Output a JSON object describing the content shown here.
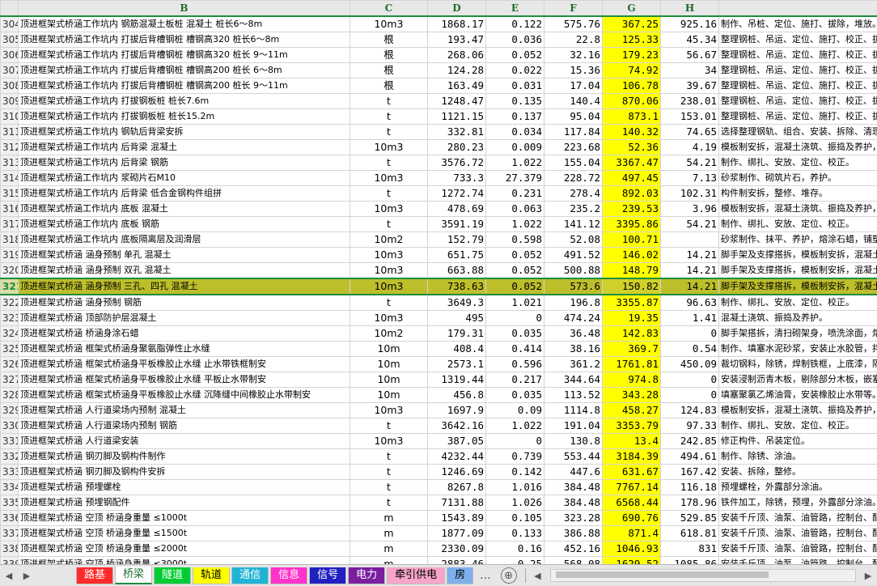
{
  "columns": [
    "B",
    "C",
    "D",
    "E",
    "F",
    "G",
    "H"
  ],
  "rows": [
    {
      "n": "304",
      "b": "顶进框架式桥涵工作坑内 钢筋混凝土板桩 混凝土 桩长6～8m",
      "c": "10m3",
      "d": "1868.17",
      "e": "0.122",
      "f": "575.76",
      "g": "367.25",
      "h": "925.16",
      "i": "制作、吊桩、定位、施打、拔除，堆放。"
    },
    {
      "n": "305",
      "b": "顶进框架式桥涵工作坑内 打拔后背槽钢桩 槽钢高320 桩长6～8m",
      "c": "根",
      "d": "193.47",
      "e": "0.036",
      "f": "22.8",
      "g": "125.33",
      "h": "45.34",
      "i": "整理钢桩、吊运、定位、施打、校正、拔"
    },
    {
      "n": "306",
      "b": "顶进框架式桥涵工作坑内 打拔后背槽钢桩 槽钢高320 桩长 9～11m",
      "c": "根",
      "d": "268.06",
      "e": "0.052",
      "f": "32.16",
      "g": "179.23",
      "h": "56.67",
      "i": "整理钢桩、吊运、定位、施打、校正、拔"
    },
    {
      "n": "307",
      "b": "顶进框架式桥涵工作坑内 打拔后背槽钢桩 槽钢高200 桩长 6～8m",
      "c": "根",
      "d": "124.28",
      "e": "0.022",
      "f": "15.36",
      "g": "74.92",
      "h": "34",
      "i": "整理钢桩、吊运、定位、施打、校正、拔"
    },
    {
      "n": "308",
      "b": "顶进框架式桥涵工作坑内 打拔后背槽钢桩 槽钢高200 桩长 9～11m",
      "c": "根",
      "d": "163.49",
      "e": "0.031",
      "f": "17.04",
      "g": "106.78",
      "h": "39.67",
      "i": "整理钢桩、吊运、定位、施打、校正、拔"
    },
    {
      "n": "309",
      "b": "顶进框架式桥涵工作坑内 打拔钢板桩 桩长7.6m",
      "c": "t",
      "d": "1248.47",
      "e": "0.135",
      "f": "140.4",
      "g": "870.06",
      "h": "238.01",
      "i": "整理钢桩、吊运、定位、施打、校正、拔"
    },
    {
      "n": "310",
      "b": "顶进框架式桥涵工作坑内 打拔钢板桩 桩长15.2m",
      "c": "t",
      "d": "1121.15",
      "e": "0.137",
      "f": "95.04",
      "g": "873.1",
      "h": "153.01",
      "i": "整理钢桩、吊运、定位、施打、校正、拔"
    },
    {
      "n": "311",
      "b": "顶进框架式桥涵工作坑内 钢轨后背梁安拆",
      "c": "t",
      "d": "332.81",
      "e": "0.034",
      "f": "117.84",
      "g": "140.32",
      "h": "74.65",
      "i": "选择整理钢轨、组合、安装、拆除、清理"
    },
    {
      "n": "312",
      "b": "顶进框架式桥涵工作坑内 后背梁 混凝土",
      "c": "10m3",
      "d": "280.23",
      "e": "0.009",
      "f": "223.68",
      "g": "52.36",
      "h": "4.19",
      "i": "模板制安拆，混凝土浇筑、振捣及养护，"
    },
    {
      "n": "313",
      "b": "顶进框架式桥涵工作坑内 后背梁 钢筋",
      "c": "t",
      "d": "3576.72",
      "e": "1.022",
      "f": "155.04",
      "g": "3367.47",
      "h": "54.21",
      "i": "制作、绑扎、安放、定位、校正。"
    },
    {
      "n": "314",
      "b": "顶进框架式桥涵工作坑内 浆砌片石M10",
      "c": "10m3",
      "d": "733.3",
      "e": "27.379",
      "f": "228.72",
      "g": "497.45",
      "h": "7.13",
      "i": "砂浆制作、砌筑片石，养护。"
    },
    {
      "n": "315",
      "b": "顶进框架式桥涵工作坑内 后背梁 低合金钢构件组拼",
      "c": "t",
      "d": "1272.74",
      "e": "0.231",
      "f": "278.4",
      "g": "892.03",
      "h": "102.31",
      "i": "构件制安拆，整修、堆存。"
    },
    {
      "n": "316",
      "b": "顶进框架式桥涵工作坑内 底板 混凝土",
      "c": "10m3",
      "d": "478.69",
      "e": "0.063",
      "f": "235.2",
      "g": "239.53",
      "h": "3.96",
      "i": "模板制安拆，混凝土浇筑、振捣及养护，"
    },
    {
      "n": "317",
      "b": "顶进框架式桥涵工作坑内 底板 钢筋",
      "c": "t",
      "d": "3591.19",
      "e": "1.022",
      "f": "141.12",
      "g": "3395.86",
      "h": "54.21",
      "i": "制作、绑扎、安放、定位、校正。"
    },
    {
      "n": "318",
      "b": "顶进框架式桥涵工作坑内 底板隔离层及润滑层",
      "c": "10m2",
      "d": "152.79",
      "e": "0.598",
      "f": "52.08",
      "g": "100.71",
      "h": "",
      "i": "砂浆制作、抹平、养护，熔涂石蜡，铺塑"
    },
    {
      "n": "319",
      "b": "顶进框架式桥涵 涵身预制 单孔 混凝土",
      "c": "10m3",
      "d": "651.75",
      "e": "0.052",
      "f": "491.52",
      "g": "146.02",
      "h": "14.21",
      "i": "脚手架及支撑搭拆，模板制安拆，混凝土"
    },
    {
      "n": "320",
      "b": "顶进框架式桥涵 涵身预制 双孔 混凝土",
      "c": "10m3",
      "d": "663.88",
      "e": "0.052",
      "f": "500.88",
      "g": "148.79",
      "h": "14.21",
      "i": "脚手架及支撑搭拆，模板制安拆，混凝土"
    },
    {
      "n": "321",
      "b": "顶进框架式桥涵 涵身预制 三孔、四孔 混凝土",
      "c": "10m3",
      "d": "738.63",
      "e": "0.052",
      "f": "573.6",
      "g": "150.82",
      "h": "14.21",
      "i": "脚手架及支撑搭拆，模板制安拆，混凝土",
      "sel": true
    },
    {
      "n": "322",
      "b": "顶进框架式桥涵 涵身预制 钢筋",
      "c": "t",
      "d": "3649.3",
      "e": "1.021",
      "f": "196.8",
      "g": "3355.87",
      "h": "96.63",
      "i": "制作、绑扎、安放、定位、校正。"
    },
    {
      "n": "323",
      "b": "顶进框架式桥涵 顶部防护层混凝土",
      "c": "10m3",
      "d": "495",
      "e": "0",
      "f": "474.24",
      "g": "19.35",
      "h": "1.41",
      "i": "混凝土浇筑、振捣及养护。"
    },
    {
      "n": "324",
      "b": "顶进框架式桥涵 桥涵身涂石蜡",
      "c": "10m2",
      "d": "179.31",
      "e": "0.035",
      "f": "36.48",
      "g": "142.83",
      "h": "0",
      "i": "脚手架搭拆，清扫砌架身，喷洗涂面，熔"
    },
    {
      "n": "325",
      "b": "顶进框架式桥涵 框架式桥涵身聚氨脂弹性止水缝",
      "c": "10m",
      "d": "408.4",
      "e": "0.414",
      "f": "38.16",
      "g": "369.7",
      "h": "0.54",
      "i": "制作、填塞水泥砂浆，安装止水胶管，拌"
    },
    {
      "n": "326",
      "b": "顶进框架式桥涵 框架式桥涵身平板橡胶止水缝 止水带铁框制安",
      "c": "10m",
      "d": "2573.1",
      "e": "0.596",
      "f": "361.2",
      "g": "1761.81",
      "h": "450.09",
      "i": "裁切钢料，除锈，焊制铁框，上底漆，隔"
    },
    {
      "n": "327",
      "b": "顶进框架式桥涵 框架式桥涵身平板橡胶止水缝 平板止水带制安",
      "c": "10m",
      "d": "1319.44",
      "e": "0.217",
      "f": "344.64",
      "g": "974.8",
      "h": "0",
      "i": "安装浸制沥青木板，剔除部分木板，嵌塞"
    },
    {
      "n": "328",
      "b": "顶进框架式桥涵 框架式桥涵身平板橡胶止水缝 沉降缝中间橡胶止水带制安",
      "c": "10m",
      "d": "456.8",
      "e": "0.035",
      "f": "113.52",
      "g": "343.28",
      "h": "0",
      "i": "填塞聚氯乙烯油膏，安装橡胶止水带等。"
    },
    {
      "n": "329",
      "b": "顶进框架式桥涵 人行道梁场内预制 混凝土",
      "c": "10m3",
      "d": "1697.9",
      "e": "0.09",
      "f": "1114.8",
      "g": "458.27",
      "h": "124.83",
      "i": "模板制安拆，混凝土浇筑、振捣及养护，"
    },
    {
      "n": "330",
      "b": "顶进框架式桥涵 人行道梁场内预制 钢筋",
      "c": "t",
      "d": "3642.16",
      "e": "1.022",
      "f": "191.04",
      "g": "3353.79",
      "h": "97.33",
      "i": "制作、绑扎、安放、定位、校正。"
    },
    {
      "n": "331",
      "b": "顶进框架式桥涵 人行道梁安装",
      "c": "10m3",
      "d": "387.05",
      "e": "0",
      "f": "130.8",
      "g": "13.4",
      "h": "242.85",
      "i": "修正构件、吊装定位。"
    },
    {
      "n": "332",
      "b": "顶进框架式桥涵 钢刃脚及钢构件制作",
      "c": "t",
      "d": "4232.44",
      "e": "0.739",
      "f": "553.44",
      "g": "3184.39",
      "h": "494.61",
      "i": "制作、除锈、涂油。"
    },
    {
      "n": "333",
      "b": "顶进框架式桥涵 钢刃脚及钢构件安拆",
      "c": "t",
      "d": "1246.69",
      "e": "0.142",
      "f": "447.6",
      "g": "631.67",
      "h": "167.42",
      "i": "安装、拆除，整修。"
    },
    {
      "n": "334",
      "b": "顶进框架式桥涵 预埋螺栓",
      "c": "t",
      "d": "8267.8",
      "e": "1.016",
      "f": "384.48",
      "g": "7767.14",
      "h": "116.18",
      "i": "预埋螺栓，外露部分涂油。"
    },
    {
      "n": "335",
      "b": "顶进框架式桥涵 预埋钢配件",
      "c": "t",
      "d": "7131.88",
      "e": "1.026",
      "f": "384.48",
      "g": "6568.44",
      "h": "178.96",
      "i": "铁件加工，除锈，预埋，外露部分涂油。"
    },
    {
      "n": "336",
      "b": "顶进框架式桥涵 空顶 桥涵身重量 ≤1000t",
      "c": "m",
      "d": "1543.89",
      "e": "0.105",
      "f": "323.28",
      "g": "690.76",
      "h": "529.85",
      "i": "安装千斤顶、油泵、油管路，控制台、配"
    },
    {
      "n": "337",
      "b": "顶进框架式桥涵 空顶 桥涵身重量 ≤1500t",
      "c": "m",
      "d": "1877.09",
      "e": "0.133",
      "f": "386.88",
      "g": "871.4",
      "h": "618.81",
      "i": "安装千斤顶、油泵、油管路，控制台、配"
    },
    {
      "n": "338",
      "b": "顶进框架式桥涵 空顶 桥涵身重量 ≤2000t",
      "c": "m",
      "d": "2330.09",
      "e": "0.16",
      "f": "452.16",
      "g": "1046.93",
      "h": "831",
      "i": "安装千斤顶、油泵、油管路，控制台、配"
    },
    {
      "n": "339",
      "b": "顶进框架式桥涵 空顶 桥涵身重量 ≤3000t",
      "c": "m",
      "d": "2883.46",
      "e": "0.25",
      "f": "568.08",
      "g": "1629.52",
      "h": "1085.86",
      "i": "安装千斤顶、油泵、油管路，控制台、配"
    }
  ],
  "tabs": [
    {
      "label": "路基",
      "bg": "#ff2a2a",
      "fg": "#ffffff"
    },
    {
      "label": "桥梁",
      "bg": "#ffffff",
      "fg": "#1e6b2e",
      "active": true
    },
    {
      "label": "隧道",
      "bg": "#00cc33",
      "fg": "#ffffff"
    },
    {
      "label": "轨道",
      "bg": "#ffff00",
      "fg": "#000000"
    },
    {
      "label": "通信",
      "bg": "#1fb3d6",
      "fg": "#ffffff"
    },
    {
      "label": "信息",
      "bg": "#ff33cc",
      "fg": "#ffffff"
    },
    {
      "label": "信号",
      "bg": "#2020c0",
      "fg": "#ffffff"
    },
    {
      "label": "电力",
      "bg": "#7a1fa0",
      "fg": "#ffffff"
    },
    {
      "label": "牵引供电",
      "bg": "#f7a5c8",
      "fg": "#000000"
    },
    {
      "label": "房",
      "bg": "#7fb0ee",
      "fg": "#000000"
    }
  ],
  "tabbar": {
    "ellipsis": "...",
    "add_symbol": "⊕"
  },
  "colors": {
    "highlight_col": "#ffff00",
    "selected_row": "#bcbf2a",
    "header_green": "#1e8c3e"
  }
}
